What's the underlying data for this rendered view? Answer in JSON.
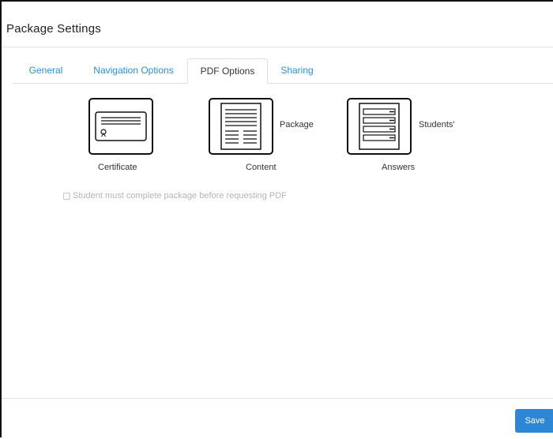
{
  "dialog": {
    "title": "Package Settings"
  },
  "tabs": [
    {
      "label": "General",
      "active": false
    },
    {
      "label": "Navigation Options",
      "active": false
    },
    {
      "label": "PDF Options",
      "active": true
    },
    {
      "label": "Sharing",
      "active": false
    }
  ],
  "pdf_options": [
    {
      "icon": "certificate-icon",
      "label": "Certificate"
    },
    {
      "icon": "package-content-icon",
      "label_line1": "Package",
      "label_line2": "Content"
    },
    {
      "icon": "students-answers-icon",
      "label_line1": "Students'",
      "label_line2": "Answers"
    }
  ],
  "requirement": {
    "label": "Student must complete package before requesting PDF",
    "checked": false,
    "disabled": true
  },
  "footer": {
    "save_label": "Save"
  },
  "colors": {
    "accent": "#2e86d6",
    "tab_link": "#2b8fd8",
    "border": "#111111"
  }
}
